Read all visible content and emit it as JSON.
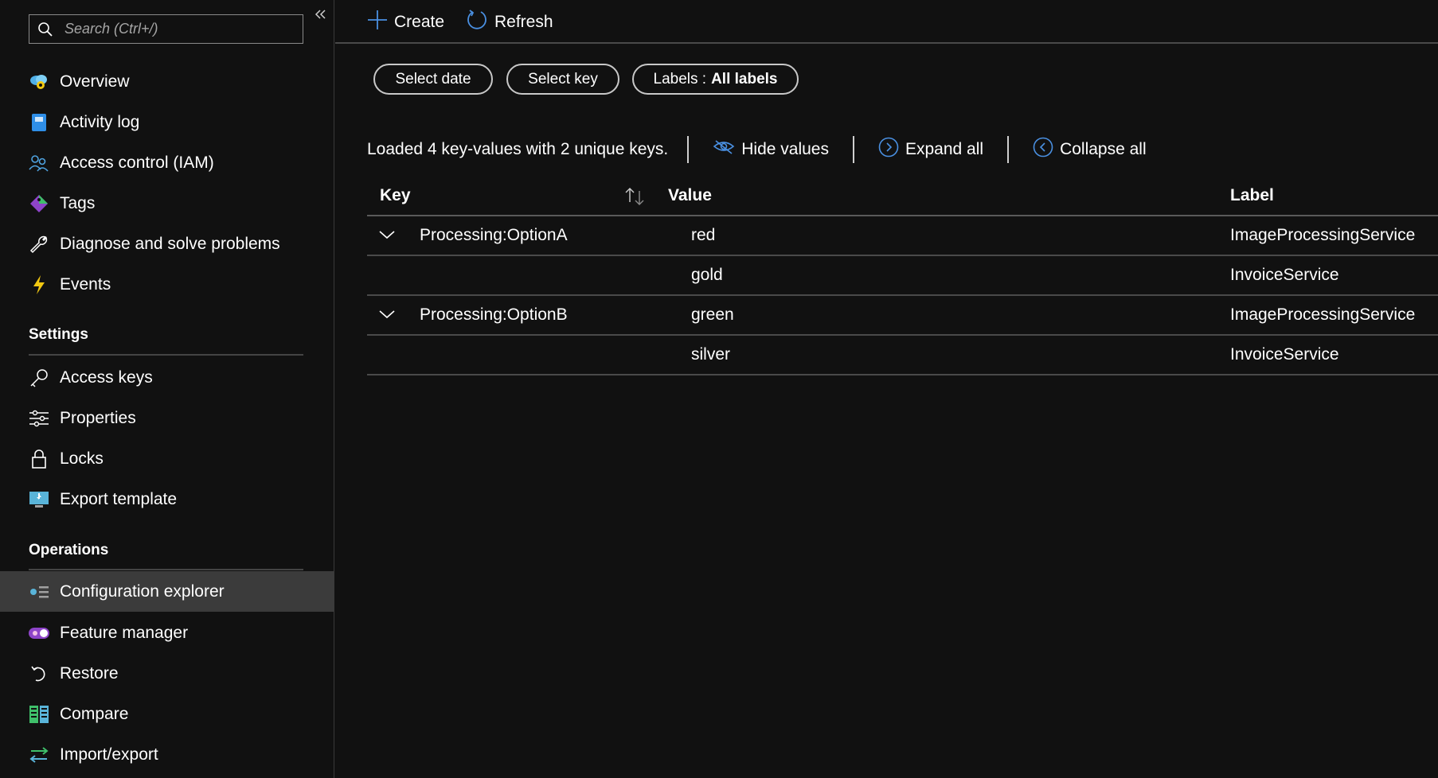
{
  "sidebar": {
    "search_placeholder": "Search (Ctrl+/)",
    "items_top": [
      {
        "label": "Overview",
        "icon": "overview-cloud-gear-icon"
      },
      {
        "label": "Activity log",
        "icon": "activity-log-icon"
      },
      {
        "label": "Access control (IAM)",
        "icon": "people-icon"
      },
      {
        "label": "Tags",
        "icon": "tag-icon"
      },
      {
        "label": "Diagnose and solve problems",
        "icon": "wrench-icon"
      },
      {
        "label": "Events",
        "icon": "lightning-icon"
      }
    ],
    "settings_heading": "Settings",
    "items_settings": [
      {
        "label": "Access keys",
        "icon": "key-icon"
      },
      {
        "label": "Properties",
        "icon": "sliders-icon"
      },
      {
        "label": "Locks",
        "icon": "lock-icon"
      },
      {
        "label": "Export template",
        "icon": "export-template-icon"
      }
    ],
    "operations_heading": "Operations",
    "items_operations": [
      {
        "label": "Configuration explorer",
        "icon": "configuration-explorer-icon",
        "active": true
      },
      {
        "label": "Feature manager",
        "icon": "feature-manager-icon"
      },
      {
        "label": "Restore",
        "icon": "restore-icon"
      },
      {
        "label": "Compare",
        "icon": "compare-icon"
      },
      {
        "label": "Import/export",
        "icon": "import-export-icon"
      }
    ]
  },
  "toolbar": {
    "create_label": "Create",
    "refresh_label": "Refresh"
  },
  "filters": {
    "select_date": "Select date",
    "select_key": "Select key",
    "labels_prefix": "Labels :",
    "labels_value": "All labels"
  },
  "info": {
    "loaded_text": "Loaded 4 key-values with 2 unique keys.",
    "hide_values": "Hide values",
    "expand_all": "Expand all",
    "collapse_all": "Collapse all"
  },
  "table": {
    "columns": {
      "key": "Key",
      "value": "Value",
      "label": "Label"
    },
    "rows": [
      {
        "key": "Processing:OptionA",
        "value": "red",
        "label": "ImageProcessingService",
        "expandable": true
      },
      {
        "key": "",
        "value": "gold",
        "label": "InvoiceService",
        "expandable": false
      },
      {
        "key": "Processing:OptionB",
        "value": "green",
        "label": "ImageProcessingService",
        "expandable": true
      },
      {
        "key": "",
        "value": "silver",
        "label": "InvoiceService",
        "expandable": false
      }
    ]
  },
  "colors": {
    "accent_blue": "#4a90e2",
    "active_row": "#3b3b3b",
    "background": "#111111"
  }
}
